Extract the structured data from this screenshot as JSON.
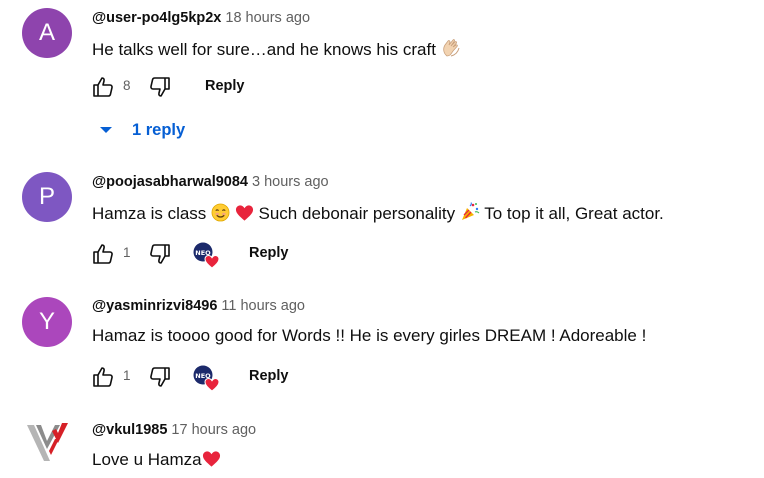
{
  "comments": [
    {
      "avatar_letter": "A",
      "avatar_color": "#8e44ad",
      "author": "@user-po4lg5kp2x",
      "time": "18 hours ago",
      "text": "He talks well for sure…and he knows his craft",
      "likes": "8",
      "reply_label": "Reply",
      "replies_label": "1 reply"
    },
    {
      "avatar_letter": "P",
      "avatar_color": "#7e57c2",
      "author": "@poojasabharwal9084",
      "time": "3 hours ago",
      "text_part1": "Hamza is class",
      "text_part2": "Such debonair personality",
      "text_part3": "To top it all, Great actor.",
      "likes": "1",
      "reply_label": "Reply",
      "creator_badge": "NEO"
    },
    {
      "avatar_letter": "Y",
      "avatar_color": "#ab47bc",
      "author": "@yasminrizvi8496",
      "time": "11 hours ago",
      "text": "Hamaz is toooo good for Words !! He is every girles DREAM ! Adoreable !",
      "likes": "1",
      "reply_label": "Reply",
      "creator_badge": "NEO"
    },
    {
      "author": "@vkul1985",
      "time": "17 hours ago",
      "text": "Love u Hamza"
    }
  ],
  "colors": {
    "link_blue": "#065fd4",
    "heart_red": "#e8243c",
    "secondary_text": "#606060"
  }
}
